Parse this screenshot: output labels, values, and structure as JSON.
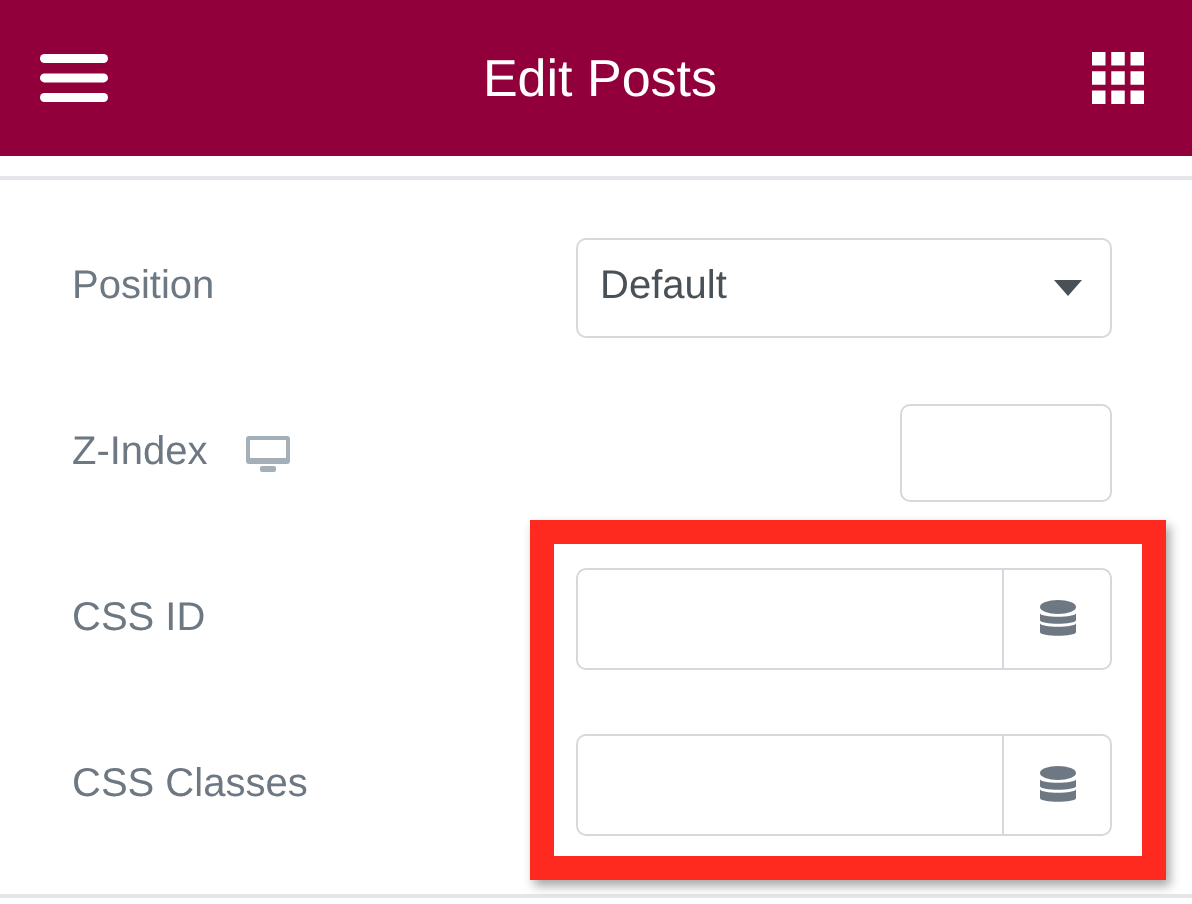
{
  "header": {
    "title": "Edit Posts"
  },
  "controls": [
    {
      "label": "Position",
      "kind": "select",
      "value": "Default",
      "responsive": false
    },
    {
      "label": "Z-Index",
      "kind": "number",
      "responsive": true
    },
    {
      "label": "CSS ID",
      "kind": "dynamic",
      "responsive": false
    },
    {
      "label": "CSS Classes",
      "kind": "dynamic",
      "responsive": false
    }
  ],
  "annotation": {
    "kind": "frame"
  }
}
